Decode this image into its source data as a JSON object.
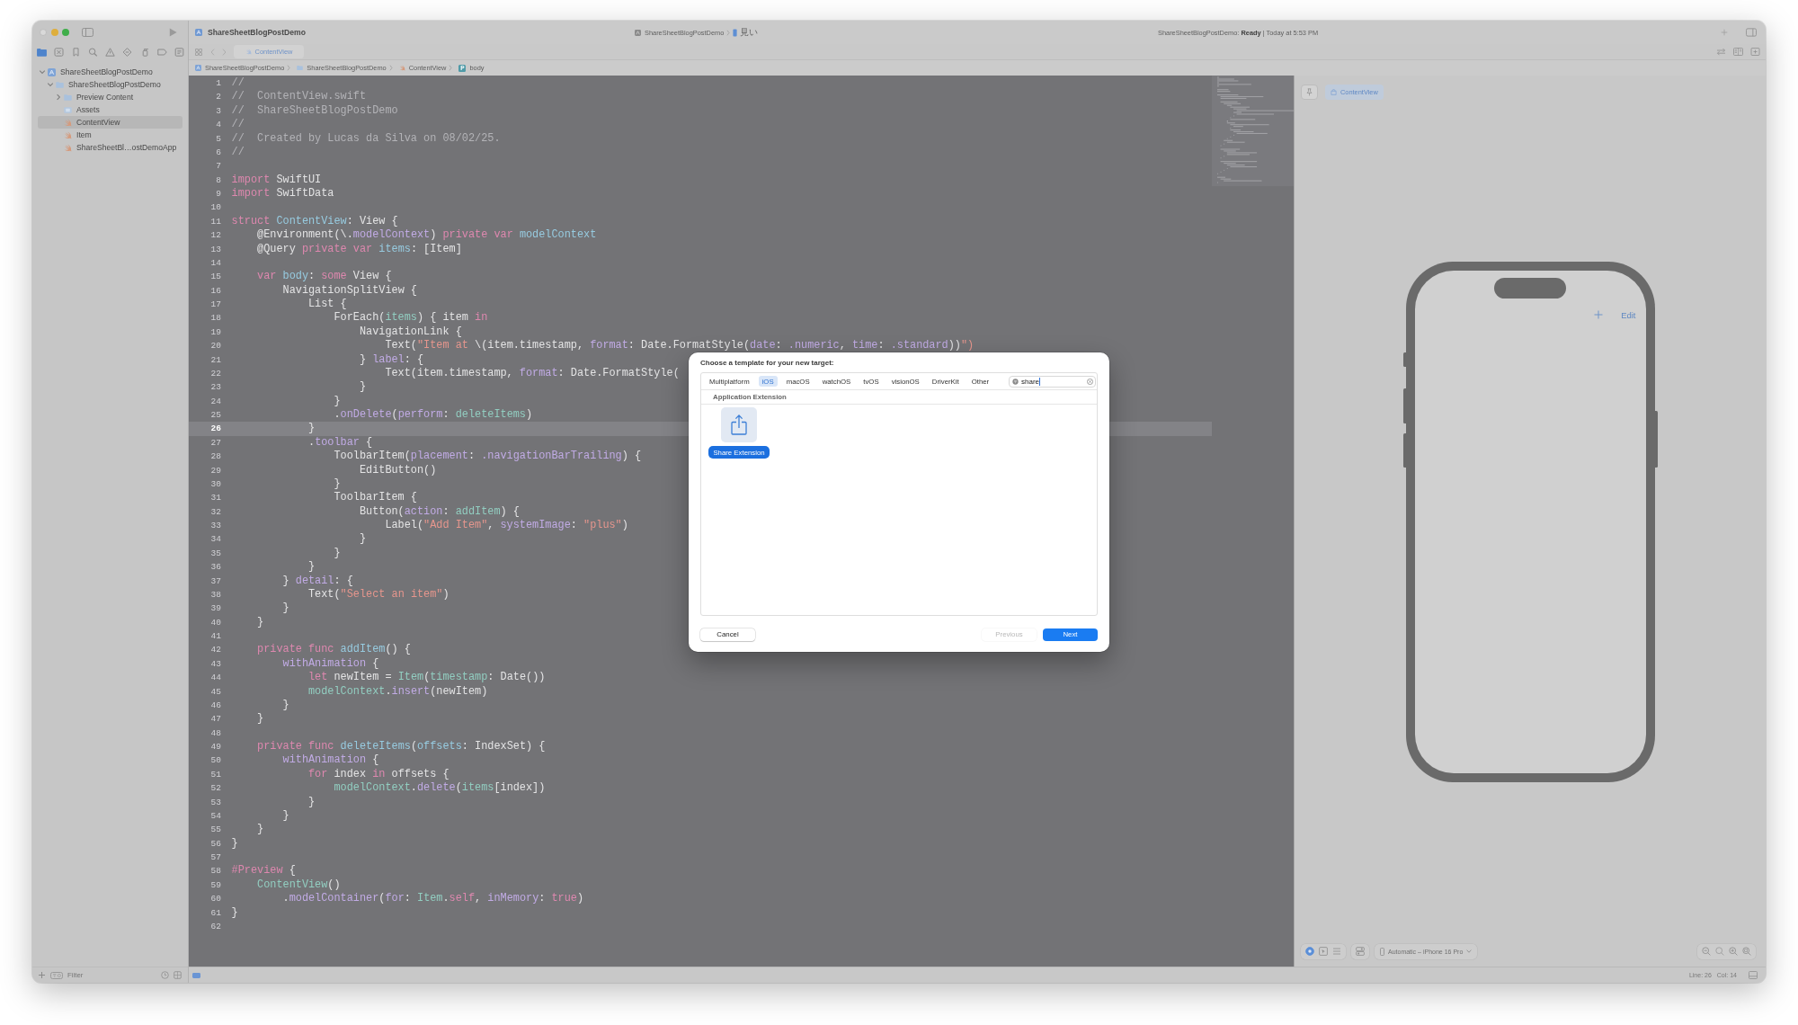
{
  "window": {
    "title": "ShareSheetBlogPostDemo"
  },
  "toolbar": {
    "scheme": "ShareSheetBlogPostDemo",
    "destination": "見い",
    "status": "ShareSheetBlogPostDemo: **Ready** | Today at 5:53 PM"
  },
  "navigator": {
    "tabs": [
      {
        "kind": "folder",
        "selected": true
      },
      {
        "kind": "sourcecontrol",
        "selected": false
      },
      {
        "kind": "bookmark",
        "selected": false
      },
      {
        "kind": "search",
        "selected": false
      },
      {
        "kind": "issue",
        "selected": false
      },
      {
        "kind": "test",
        "selected": false
      },
      {
        "kind": "debug",
        "selected": false
      },
      {
        "kind": "breakpoint",
        "selected": false
      },
      {
        "kind": "report",
        "selected": false
      }
    ],
    "tree": [
      {
        "kind": "project",
        "label": "ShareSheetBlogPostDemo",
        "expanded": true,
        "selected": false,
        "children": [
          {
            "kind": "folder",
            "label": "ShareSheetBlogPostDemo",
            "expanded": true,
            "selected": false,
            "children": [
              {
                "kind": "folder",
                "label": "Preview Content",
                "expanded": false,
                "selected": false
              },
              {
                "kind": "assets",
                "label": "Assets",
                "selected": false
              },
              {
                "kind": "swift",
                "label": "ContentView",
                "selected": true
              },
              {
                "kind": "swift",
                "label": "Item",
                "selected": false
              },
              {
                "kind": "swift",
                "label": "ShareSheetBl…ostDemoApp",
                "selected": false
              }
            ]
          }
        ]
      }
    ],
    "filter": {
      "placeholder": "Filter"
    }
  },
  "editor": {
    "tabs": [
      {
        "label": "ContentView",
        "selected": true
      }
    ],
    "breadcrumbs": [
      {
        "kind": "project",
        "label": "ShareSheetBlogPostDemo"
      },
      {
        "kind": "folder",
        "label": "ShareSheetBlogPostDemo"
      },
      {
        "kind": "swift",
        "label": "ContentView"
      },
      {
        "kind": "property",
        "badge": "P",
        "label": "body"
      }
    ],
    "lines": [
      {
        "number": "1",
        "current": false,
        "tokens": [
          {
            "text": "//",
            "kind": "comment"
          }
        ]
      },
      {
        "number": "2",
        "current": false,
        "tokens": [
          {
            "text": "//  ContentView.swift",
            "kind": "comment"
          }
        ]
      },
      {
        "number": "3",
        "current": false,
        "tokens": [
          {
            "text": "//  ShareSheetBlogPostDemo",
            "kind": "comment"
          }
        ]
      },
      {
        "number": "4",
        "current": false,
        "tokens": [
          {
            "text": "//",
            "kind": "comment"
          }
        ]
      },
      {
        "number": "5",
        "current": false,
        "tokens": [
          {
            "text": "//  Created by Lucas da Silva on 08/02/25.",
            "kind": "comment"
          }
        ]
      },
      {
        "number": "6",
        "current": false,
        "tokens": [
          {
            "text": "//",
            "kind": "comment"
          }
        ]
      },
      {
        "number": "7",
        "current": false
      },
      {
        "number": "8",
        "current": false,
        "tokens": [
          {
            "text": "import",
            "kind": "keyword"
          },
          {
            "text": " SwiftUI",
            "kind": "plain"
          }
        ]
      },
      {
        "number": "9",
        "current": false,
        "tokens": [
          {
            "text": "import",
            "kind": "keyword"
          },
          {
            "text": " SwiftData",
            "kind": "plain"
          }
        ]
      },
      {
        "number": "10",
        "current": false
      },
      {
        "number": "11",
        "current": false,
        "tokens": [
          {
            "text": "struct",
            "kind": "keyword"
          },
          {
            "text": " ContentView",
            "kind": "decl"
          },
          {
            "text": ": View {",
            "kind": "plain"
          }
        ]
      },
      {
        "number": "12",
        "current": false,
        "tokens": [
          {
            "text": "    @Environment(\\.",
            "kind": "plain"
          },
          {
            "text": "modelContext",
            "kind": "api"
          },
          {
            "text": ") ",
            "kind": "plain"
          },
          {
            "text": "private var",
            "kind": "keyword"
          },
          {
            "text": " modelContext",
            "kind": "decl"
          }
        ]
      },
      {
        "number": "13",
        "current": false,
        "tokens": [
          {
            "text": "    @Query",
            "kind": "plain"
          },
          {
            "text": " private var",
            "kind": "keyword"
          },
          {
            "text": " items",
            "kind": "decl"
          },
          {
            "text": ": [Item]",
            "kind": "plain"
          }
        ]
      },
      {
        "number": "14",
        "current": false
      },
      {
        "number": "15",
        "current": false,
        "tokens": [
          {
            "text": "    var",
            "kind": "keyword"
          },
          {
            "text": " body",
            "kind": "decl"
          },
          {
            "text": ": ",
            "kind": "plain"
          },
          {
            "text": "some",
            "kind": "keyword"
          },
          {
            "text": " View {",
            "kind": "plain"
          }
        ]
      },
      {
        "number": "16",
        "current": false,
        "tokens": [
          {
            "text": "        NavigationSplitView {",
            "kind": "plain"
          }
        ]
      },
      {
        "number": "17",
        "current": false,
        "tokens": [
          {
            "text": "            List {",
            "kind": "plain"
          }
        ]
      },
      {
        "number": "18",
        "current": false,
        "tokens": [
          {
            "text": "                ForEach(",
            "kind": "plain"
          },
          {
            "text": "items",
            "kind": "ref"
          },
          {
            "text": ") { item ",
            "kind": "plain"
          },
          {
            "text": "in",
            "kind": "keyword"
          }
        ]
      },
      {
        "number": "19",
        "current": false,
        "tokens": [
          {
            "text": "                    NavigationLink {",
            "kind": "plain"
          }
        ]
      },
      {
        "number": "20",
        "current": false,
        "tokens": [
          {
            "text": "                        Text(",
            "kind": "plain"
          },
          {
            "text": "\"Item at ",
            "kind": "string"
          },
          {
            "text": "\\(item.timestamp, ",
            "kind": "plain"
          },
          {
            "text": "format",
            "kind": "api"
          },
          {
            "text": ": Date.FormatStyle(",
            "kind": "plain"
          },
          {
            "text": "date",
            "kind": "api"
          },
          {
            "text": ": ",
            "kind": "plain"
          },
          {
            "text": ".numeric",
            "kind": "api"
          },
          {
            "text": ", ",
            "kind": "plain"
          },
          {
            "text": "time",
            "kind": "api"
          },
          {
            "text": ": ",
            "kind": "plain"
          },
          {
            "text": ".standard",
            "kind": "api"
          },
          {
            "text": "))",
            "kind": "plain"
          },
          {
            "text": "\")",
            "kind": "string"
          }
        ]
      },
      {
        "number": "21",
        "current": false,
        "tokens": [
          {
            "text": "                    } ",
            "kind": "plain"
          },
          {
            "text": "label",
            "kind": "api"
          },
          {
            "text": ": {",
            "kind": "plain"
          }
        ]
      },
      {
        "number": "22",
        "current": false,
        "tokens": [
          {
            "text": "                        Text(item.timestamp, ",
            "kind": "plain"
          },
          {
            "text": "format",
            "kind": "api"
          },
          {
            "text": ": Date.FormatStyle(",
            "kind": "plain"
          }
        ]
      },
      {
        "number": "23",
        "current": false,
        "tokens": [
          {
            "text": "                    }",
            "kind": "plain"
          }
        ]
      },
      {
        "number": "24",
        "current": false,
        "tokens": [
          {
            "text": "                }",
            "kind": "plain"
          }
        ]
      },
      {
        "number": "25",
        "current": false,
        "tokens": [
          {
            "text": "                .",
            "kind": "plain"
          },
          {
            "text": "onDelete",
            "kind": "api"
          },
          {
            "text": "(",
            "kind": "plain"
          },
          {
            "text": "perform",
            "kind": "api"
          },
          {
            "text": ": ",
            "kind": "plain"
          },
          {
            "text": "deleteItems",
            "kind": "ref"
          },
          {
            "text": ")",
            "kind": "plain"
          }
        ]
      },
      {
        "number": "26",
        "current": true,
        "tokens": [
          {
            "text": "            }",
            "kind": "plain"
          }
        ]
      },
      {
        "number": "27",
        "current": false,
        "tokens": [
          {
            "text": "            .",
            "kind": "plain"
          },
          {
            "text": "toolbar",
            "kind": "api"
          },
          {
            "text": " {",
            "kind": "plain"
          }
        ]
      },
      {
        "number": "28",
        "current": false,
        "tokens": [
          {
            "text": "                ToolbarItem(",
            "kind": "plain"
          },
          {
            "text": "placement",
            "kind": "api"
          },
          {
            "text": ": ",
            "kind": "plain"
          },
          {
            "text": ".navigationBarTrailing",
            "kind": "api"
          },
          {
            "text": ") {",
            "kind": "plain"
          }
        ]
      },
      {
        "number": "29",
        "current": false,
        "tokens": [
          {
            "text": "                    EditButton()",
            "kind": "plain"
          }
        ]
      },
      {
        "number": "30",
        "current": false,
        "tokens": [
          {
            "text": "                }",
            "kind": "plain"
          }
        ]
      },
      {
        "number": "31",
        "current": false,
        "tokens": [
          {
            "text": "                ToolbarItem {",
            "kind": "plain"
          }
        ]
      },
      {
        "number": "32",
        "current": false,
        "tokens": [
          {
            "text": "                    Button(",
            "kind": "plain"
          },
          {
            "text": "action",
            "kind": "api"
          },
          {
            "text": ": ",
            "kind": "plain"
          },
          {
            "text": "addItem",
            "kind": "ref"
          },
          {
            "text": ") {",
            "kind": "plain"
          }
        ]
      },
      {
        "number": "33",
        "current": false,
        "tokens": [
          {
            "text": "                        Label(",
            "kind": "plain"
          },
          {
            "text": "\"Add Item\"",
            "kind": "string"
          },
          {
            "text": ", ",
            "kind": "plain"
          },
          {
            "text": "systemImage",
            "kind": "api"
          },
          {
            "text": ": ",
            "kind": "plain"
          },
          {
            "text": "\"plus\"",
            "kind": "string"
          },
          {
            "text": ")",
            "kind": "plain"
          }
        ]
      },
      {
        "number": "34",
        "current": false,
        "tokens": [
          {
            "text": "                    }",
            "kind": "plain"
          }
        ]
      },
      {
        "number": "35",
        "current": false,
        "tokens": [
          {
            "text": "                }",
            "kind": "plain"
          }
        ]
      },
      {
        "number": "36",
        "current": false,
        "tokens": [
          {
            "text": "            }",
            "kind": "plain"
          }
        ]
      },
      {
        "number": "37",
        "current": false,
        "tokens": [
          {
            "text": "        } ",
            "kind": "plain"
          },
          {
            "text": "detail",
            "kind": "api"
          },
          {
            "text": ": {",
            "kind": "plain"
          }
        ]
      },
      {
        "number": "38",
        "current": false,
        "tokens": [
          {
            "text": "            Text(",
            "kind": "plain"
          },
          {
            "text": "\"Select an item\"",
            "kind": "string"
          },
          {
            "text": ")",
            "kind": "plain"
          }
        ]
      },
      {
        "number": "39",
        "current": false,
        "tokens": [
          {
            "text": "        }",
            "kind": "plain"
          }
        ]
      },
      {
        "number": "40",
        "current": false,
        "tokens": [
          {
            "text": "    }",
            "kind": "plain"
          }
        ]
      },
      {
        "number": "41",
        "current": false
      },
      {
        "number": "42",
        "current": false,
        "tokens": [
          {
            "text": "    private func",
            "kind": "keyword"
          },
          {
            "text": " addItem",
            "kind": "decl"
          },
          {
            "text": "() {",
            "kind": "plain"
          }
        ]
      },
      {
        "number": "43",
        "current": false,
        "tokens": [
          {
            "text": "        withAnimation",
            "kind": "api"
          },
          {
            "text": " {",
            "kind": "plain"
          }
        ]
      },
      {
        "number": "44",
        "current": false,
        "tokens": [
          {
            "text": "            let",
            "kind": "keyword"
          },
          {
            "text": " newItem = ",
            "kind": "plain"
          },
          {
            "text": "Item",
            "kind": "ref"
          },
          {
            "text": "(",
            "kind": "plain"
          },
          {
            "text": "timestamp",
            "kind": "ref"
          },
          {
            "text": ": Date())",
            "kind": "plain"
          }
        ]
      },
      {
        "number": "45",
        "current": false,
        "tokens": [
          {
            "text": "            modelContext",
            "kind": "ref"
          },
          {
            "text": ".",
            "kind": "plain"
          },
          {
            "text": "insert",
            "kind": "api"
          },
          {
            "text": "(newItem)",
            "kind": "plain"
          }
        ]
      },
      {
        "number": "46",
        "current": false,
        "tokens": [
          {
            "text": "        }",
            "kind": "plain"
          }
        ]
      },
      {
        "number": "47",
        "current": false,
        "tokens": [
          {
            "text": "    }",
            "kind": "plain"
          }
        ]
      },
      {
        "number": "48",
        "current": false
      },
      {
        "number": "49",
        "current": false,
        "tokens": [
          {
            "text": "    private func",
            "kind": "keyword"
          },
          {
            "text": " deleteItems",
            "kind": "decl"
          },
          {
            "text": "(",
            "kind": "plain"
          },
          {
            "text": "offsets",
            "kind": "decl"
          },
          {
            "text": ": IndexSet) {",
            "kind": "plain"
          }
        ]
      },
      {
        "number": "50",
        "current": false,
        "tokens": [
          {
            "text": "        withAnimation",
            "kind": "api"
          },
          {
            "text": " {",
            "kind": "plain"
          }
        ]
      },
      {
        "number": "51",
        "current": false,
        "tokens": [
          {
            "text": "            for",
            "kind": "keyword"
          },
          {
            "text": " index ",
            "kind": "plain"
          },
          {
            "text": "in",
            "kind": "keyword"
          },
          {
            "text": " offsets {",
            "kind": "plain"
          }
        ]
      },
      {
        "number": "52",
        "current": false,
        "tokens": [
          {
            "text": "                modelContext",
            "kind": "ref"
          },
          {
            "text": ".",
            "kind": "plain"
          },
          {
            "text": "delete",
            "kind": "api"
          },
          {
            "text": "(",
            "kind": "plain"
          },
          {
            "text": "items",
            "kind": "ref"
          },
          {
            "text": "[index])",
            "kind": "plain"
          }
        ]
      },
      {
        "number": "53",
        "current": false,
        "tokens": [
          {
            "text": "            }",
            "kind": "plain"
          }
        ]
      },
      {
        "number": "54",
        "current": false,
        "tokens": [
          {
            "text": "        }",
            "kind": "plain"
          }
        ]
      },
      {
        "number": "55",
        "current": false,
        "tokens": [
          {
            "text": "    }",
            "kind": "plain"
          }
        ]
      },
      {
        "number": "56",
        "current": false,
        "tokens": [
          {
            "text": "}",
            "kind": "plain"
          }
        ]
      },
      {
        "number": "57",
        "current": false
      },
      {
        "number": "58",
        "current": false,
        "tokens": [
          {
            "text": "#Preview",
            "kind": "keyword"
          },
          {
            "text": " {",
            "kind": "plain"
          }
        ]
      },
      {
        "number": "59",
        "current": false,
        "tokens": [
          {
            "text": "    ContentView",
            "kind": "ref"
          },
          {
            "text": "()",
            "kind": "plain"
          }
        ]
      },
      {
        "number": "60",
        "current": false,
        "tokens": [
          {
            "text": "        .",
            "kind": "plain"
          },
          {
            "text": "modelContainer",
            "kind": "api"
          },
          {
            "text": "(",
            "kind": "plain"
          },
          {
            "text": "for",
            "kind": "api"
          },
          {
            "text": ": ",
            "kind": "plain"
          },
          {
            "text": "Item",
            "kind": "ref"
          },
          {
            "text": ".",
            "kind": "plain"
          },
          {
            "text": "self",
            "kind": "keyword"
          },
          {
            "text": ", ",
            "kind": "plain"
          },
          {
            "text": "inMemory",
            "kind": "api"
          },
          {
            "text": ": ",
            "kind": "plain"
          },
          {
            "text": "true",
            "kind": "keyword"
          },
          {
            "text": ")",
            "kind": "plain"
          }
        ]
      },
      {
        "number": "61",
        "current": false,
        "tokens": [
          {
            "text": "}",
            "kind": "plain"
          }
        ]
      },
      {
        "number": "62",
        "current": false
      }
    ]
  },
  "preview": {
    "chip": "ContentView",
    "phone": {
      "edit_label": "Edit"
    },
    "modes": [
      {
        "kind": "live",
        "selected": true
      },
      {
        "kind": "selectable",
        "selected": false
      },
      {
        "kind": "variants",
        "selected": false
      }
    ],
    "device": "Automatic – iPhone 16 Pro"
  },
  "status_bar": {
    "line": "Line: 26",
    "column": "Col: 14"
  },
  "dialog": {
    "title": "Choose a template for your new target:",
    "platforms": [
      {
        "label": "Multiplatform",
        "selected": false
      },
      {
        "label": "iOS",
        "selected": true
      },
      {
        "label": "macOS",
        "selected": false
      },
      {
        "label": "watchOS",
        "selected": false
      },
      {
        "label": "tvOS",
        "selected": false
      },
      {
        "label": "visionOS",
        "selected": false
      },
      {
        "label": "DriverKit",
        "selected": false
      },
      {
        "label": "Other",
        "selected": false
      }
    ],
    "search": {
      "value": "share"
    },
    "sections": [
      {
        "title": "Application Extension",
        "templates": [
          {
            "kind": "share",
            "label": "Share Extension",
            "selected": true
          }
        ]
      }
    ],
    "buttons": [
      {
        "label": "Cancel",
        "kind": "normal",
        "disabled": false
      },
      {
        "label": "Previous",
        "kind": "normal",
        "disabled": true
      },
      {
        "label": "Next",
        "kind": "default",
        "disabled": false
      }
    ]
  }
}
